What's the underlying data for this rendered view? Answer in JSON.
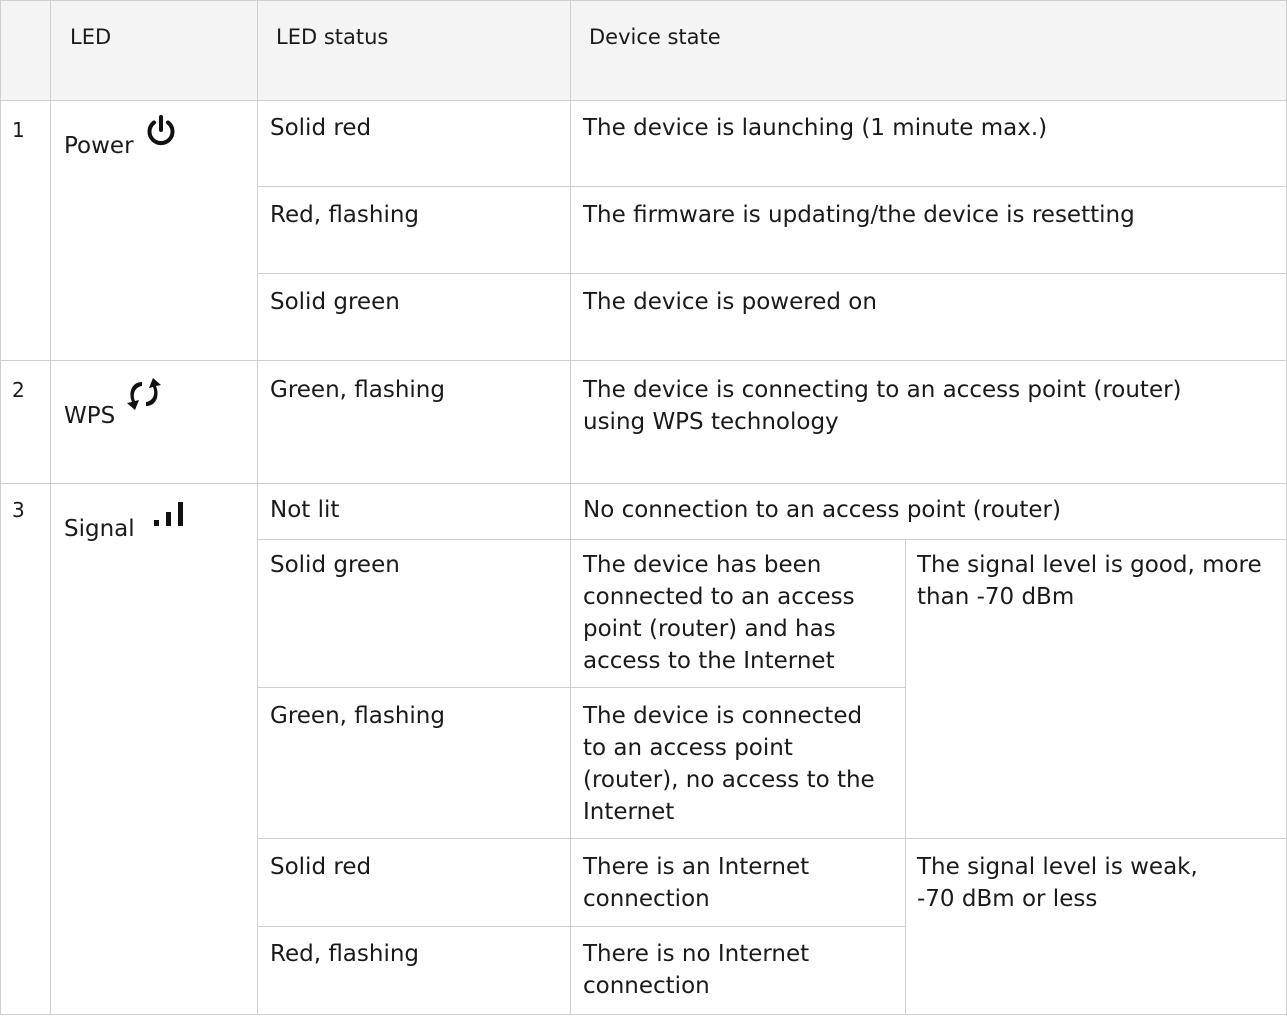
{
  "header": {
    "col_led": "LED",
    "col_status": "LED status",
    "col_state": "Device state"
  },
  "groups": [
    {
      "number": "1",
      "name": "Power",
      "icon": "power-icon",
      "rows": [
        {
          "status": "Solid red",
          "state": "The device is launching (1 minute max.)"
        },
        {
          "status": "Red, flashing",
          "state": "The firmware is updating/the device is resetting"
        },
        {
          "status": "Solid green",
          "state": "The device is powered on"
        }
      ]
    },
    {
      "number": "2",
      "name": "WPS",
      "icon": "wps-icon",
      "rows": [
        {
          "status": "Green, flashing",
          "state_lines": [
            "The device is connecting to an access point (router)",
            "using WPS technology"
          ]
        }
      ]
    },
    {
      "number": "3",
      "name": "Signal",
      "icon": "signal-bars-icon",
      "rows": [
        {
          "status": "Not lit",
          "state": "No connection to an access point (router)"
        },
        {
          "status": "Solid green",
          "state_lines": [
            "The device has been",
            "connected to an access",
            "point (router) and has",
            "access to the Internet"
          ]
        },
        {
          "status": "Green, flashing",
          "state_lines": [
            "The device is connected",
            "to an access point",
            "(router), no access to the",
            "Internet"
          ]
        },
        {
          "status": "Solid red",
          "state_lines": [
            "There is an Internet",
            "connection"
          ]
        },
        {
          "status": "Red, flashing",
          "state_lines": [
            "There is no Internet",
            "connection"
          ]
        }
      ],
      "signal_notes": [
        {
          "lines": [
            "The signal level is good, more",
            "than -70 dBm"
          ]
        },
        {
          "lines": [
            "The signal level is weak,",
            "-70 dBm or less"
          ]
        }
      ]
    }
  ]
}
